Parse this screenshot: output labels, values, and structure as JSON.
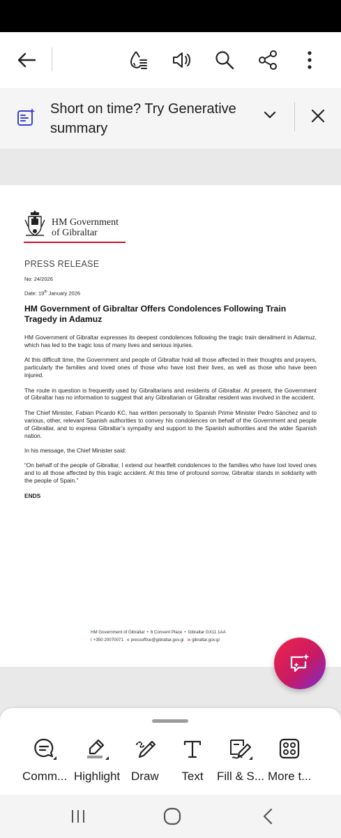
{
  "toolbar": {
    "back": "back-arrow-icon",
    "icons": [
      "liquid-mode-icon",
      "read-aloud-icon",
      "search-icon",
      "share-icon",
      "more-vertical-icon"
    ]
  },
  "banner": {
    "text": "Short on time? Try Generative summary"
  },
  "document": {
    "org_line1": "HM Government",
    "org_line2": "of Gibraltar",
    "press_release": "PRESS RELEASE",
    "number": "No: 24/2026",
    "date_prefix": "Date: 19",
    "date_sup": "th",
    "date_suffix": " January 2026",
    "title": "HM Government of Gibraltar Offers Condolences Following Train Tragedy in Adamuz",
    "paragraphs": [
      "HM Government of Gibraltar expresses its deepest condolences following the tragic train derailment in Adamuz, which has led to the tragic loss of many lives and serious injuries.",
      "At this difficult time, the Government and people of Gibraltar hold all those affected in their thoughts and prayers, particularly the families and loved ones of those who have lost their lives, as well as those who have been injured.",
      "The route in question is frequently used by Gibraltarians and residents of Gibraltar. At present, the Government of Gibraltar has no information to suggest that any Gibraltarian or Gibraltar resident was involved in the accident.",
      "The Chief Minister, Fabian Picardo KC, has written personally to Spanish Prime Minister Pedro Sánchez and to various, other, relevant Spanish authorities to convey his condolences on behalf of the Government and people of Gibraltar, and to express Gibraltar’s sympathy and support to the Spanish authorities and the wider Spanish nation.",
      "In his message, the Chief Minister said:",
      "“On behalf of the people of Gibraltar, I extend our heartfelt condolences to the families who have lost loved ones and to all those affected by this tragic accident. At this time of profound sorrow, Gibraltar stands in solidarity with the people of Spain.”"
    ],
    "ends": "ENDS",
    "footer": {
      "org": "HM Government of Gibraltar",
      "address": "6 Convent Place",
      "postcode": "Gibraltar GX11 1AA",
      "t_prefix": "t",
      "phone": "+350 20070071",
      "e_prefix": "e",
      "email": "pressoffice@gibraltar.gov.gi",
      "w_prefix": "w",
      "web": "gibraltar.gov.gi"
    }
  },
  "tools": [
    {
      "label": "Comm...",
      "icon": "comment-icon"
    },
    {
      "label": "Highlight",
      "icon": "highlight-icon"
    },
    {
      "label": "Draw",
      "icon": "draw-icon"
    },
    {
      "label": "Text",
      "icon": "text-icon"
    },
    {
      "label": "Fill & S...",
      "icon": "fill-sign-icon"
    },
    {
      "label": "More t...",
      "icon": "more-tools-icon"
    }
  ],
  "colors": {
    "brand_red": "#c8102e",
    "banner_icon": "#3d3fd1",
    "fab_gradient": [
      "#f0244a",
      "#7a2bd0"
    ]
  }
}
